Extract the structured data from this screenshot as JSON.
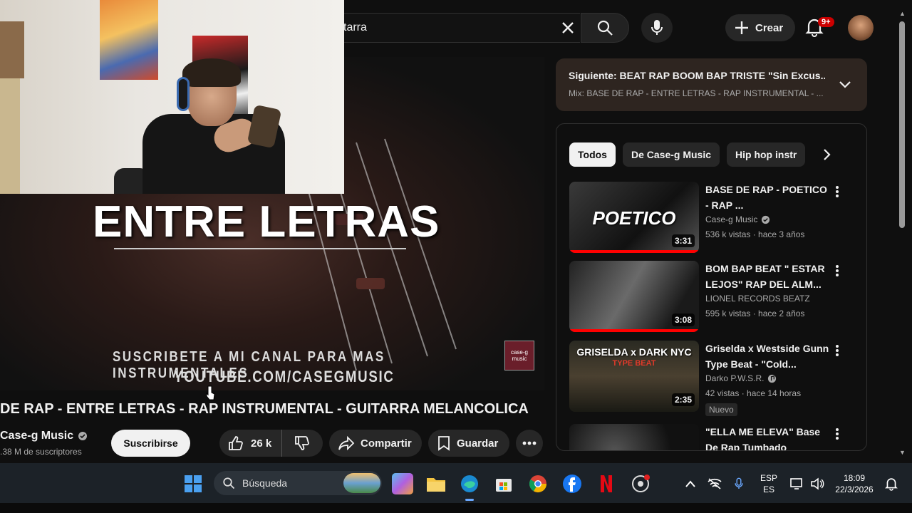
{
  "topbar": {
    "search_value": "tarra",
    "create_label": "Crear",
    "notification_count": "9+"
  },
  "video": {
    "overlay_title": "ENTRE LETRAS",
    "overlay_sub1": "SUSCRIBETE A MI CANAL PARA MAS INSTRUMENTALES",
    "overlay_sub2": "YOUTUBE.COM/CASEGMUSIC",
    "logo_text": "case-g music",
    "title": "DE RAP - ENTRE LETRAS - RAP INSTRUMENTAL - GUITARRA MELANCOLICA",
    "channel": "Case-g Music",
    "subscribers": ".38 M de suscriptores",
    "subscribe_label": "Suscribirse",
    "likes": "26 k",
    "share_label": "Compartir",
    "save_label": "Guardar"
  },
  "playlist": {
    "next": "Siguiente: BEAT RAP BOOM BAP TRISTE \"Sin Excus...",
    "mix": "Mix: BASE DE RAP - ENTRE LETRAS - RAP INSTRUMENTAL - ..."
  },
  "chips": [
    "Todos",
    "De Case-g Music",
    "Hip hop instr"
  ],
  "related": [
    {
      "title": "BASE DE RAP  - POETICO - RAP ...",
      "channel": "Case-g Music",
      "meta": "536 k vistas · hace 3 años",
      "duration": "3:31",
      "thumb_text": "POETICO"
    },
    {
      "title": "BOM BAP BEAT \" ESTAR LEJOS\"  RAP DEL ALM...",
      "channel": "LIONEL RECORDS BEATZ",
      "meta": "595 k vistas · hace 2 años",
      "duration": "3:08",
      "thumb_text": ""
    },
    {
      "title": "Griselda x Westside Gunn Type Beat - \"Cold...",
      "channel": "Darko P.W.S.R.",
      "meta": "42 vistas · hace 14 horas",
      "duration": "2:35",
      "thumb_text": "GRISELDA x DARK NYC",
      "thumb_sub": "TYPE BEAT",
      "badge": "Nuevo"
    },
    {
      "title": "\"ELLA ME ELEVA\" Base De Rap Tumbado",
      "channel": "",
      "meta": "",
      "duration": "",
      "thumb_text": ""
    }
  ],
  "taskbar": {
    "search_placeholder": "Búsqueda",
    "lang1": "ESP",
    "lang2": "ES",
    "time": "18:09",
    "date": "22/3/2026"
  }
}
